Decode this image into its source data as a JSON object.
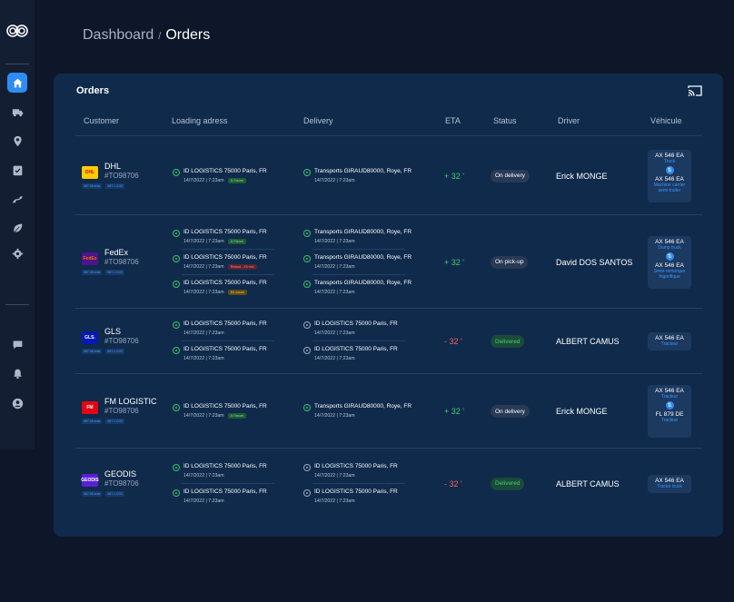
{
  "breadcrumb": {
    "parent": "Dashboard",
    "separator": "/",
    "current": "Orders"
  },
  "orders_title": "Orders",
  "columns": [
    "Customer",
    "Loading adress",
    "Delivery",
    "ETA",
    "Status",
    "Driver",
    "Véhicule"
  ],
  "sidebar": {
    "nav": [
      "home-icon",
      "truck-icon",
      "map-pin-icon",
      "clipboard-check-icon",
      "route-icon",
      "leaf-icon",
      "gear-icon"
    ],
    "bottom": [
      "chat-icon",
      "bell-icon",
      "user-icon"
    ],
    "accent": "#2f8cf4"
  },
  "rows": [
    {
      "customer": {
        "name": "DHL",
        "id": "#TO98706",
        "logo_text": "DHL",
        "logo_bg": "#ffcc00",
        "logo_fg": "#d40511",
        "tags": [
          "987.08 ents",
          "987.1 CO2"
        ]
      },
      "loading": [
        {
          "addr": "ID LOGISTICS 75000 Paris, FR",
          "time": "14/7/2022 | 7:23am",
          "badge": "A l'heure",
          "badge_type": "green"
        }
      ],
      "delivery": [
        {
          "addr": "Transports GIRAUD80000, Roye, FR",
          "time": "14/7/2022 | 7:23am"
        }
      ],
      "eta": "+ 32 '",
      "eta_type": "pos",
      "status": "On delivery",
      "status_type": "grey",
      "driver": "Erick MONGE",
      "vehicles": [
        {
          "plate": "AX 546 EA",
          "type": "Truck"
        },
        {
          "plate": "AX 546 EA",
          "type": "Machine carrier semi-trailer"
        }
      ]
    },
    {
      "customer": {
        "name": "FedEx",
        "id": "#TO98706",
        "logo_text": "FedEx",
        "logo_bg": "#4d148c",
        "logo_fg": "#ff6600",
        "tags": [
          "987.08 ents",
          "987.1 CO2"
        ]
      },
      "loading": [
        {
          "addr": "ID LOGISTICS 75000 Paris, FR",
          "time": "14/7/2022 | 7:23am",
          "badge": "A l'heure",
          "badge_type": "green"
        },
        {
          "addr": "ID LOGISTICS 75000 Paris, FR",
          "time": "14/7/2022 | 7:23am",
          "badge": "Retard - 25 min",
          "badge_type": "red"
        },
        {
          "addr": "ID LOGISTICS 75000 Paris, FR",
          "time": "14/7/2022 | 7:23am",
          "badge": "En cours",
          "badge_type": "amber"
        }
      ],
      "delivery": [
        {
          "addr": "Transports GIRAUD80000, Roye, FR",
          "time": "14/7/2022 | 7:23am"
        },
        {
          "addr": "Transports GIRAUD80000, Roye, FR",
          "time": "14/7/2022 | 7:23am"
        },
        {
          "addr": "Transports GIRAUD80000, Roye, FR",
          "time": "14/7/2022 | 7:23am"
        }
      ],
      "eta": "+ 32 '",
      "eta_type": "pos",
      "status": "On pick-up",
      "status_type": "grey",
      "driver": "David DOS SANTOS",
      "vehicles": [
        {
          "plate": "AX 546 EA",
          "type": "Dump truck"
        },
        {
          "plate": "AX 546 EA",
          "type": "Semi-remorque frigorifique"
        }
      ]
    },
    {
      "customer": {
        "name": "GLS",
        "id": "#TO98706",
        "logo_text": "GLS.",
        "logo_bg": "#061ab1",
        "logo_fg": "#ffffff",
        "tags": [
          "987.08 ents",
          "987.1 CO2"
        ]
      },
      "loading": [
        {
          "addr": "ID LOGISTICS 75000 Paris, FR",
          "time": "14/7/2022 | 7:23am"
        },
        {
          "addr": "ID LOGISTICS 75000 Paris, FR",
          "time": "14/7/2022 | 7:23am"
        }
      ],
      "delivery": [
        {
          "addr": "ID LOGISTICS 75000 Paris, FR",
          "time": "14/7/2022 | 7:23am"
        },
        {
          "addr": "ID LOGISTICS 75000 Paris, FR",
          "time": "14/7/2022 | 7:23am"
        }
      ],
      "eta": "- 32 '",
      "eta_type": "neg",
      "status": "Delivered",
      "status_type": "green",
      "driver": "ALBERT CAMUS",
      "vehicles": [
        {
          "plate": "AX 546 EA",
          "type": "Tracteur"
        }
      ]
    },
    {
      "customer": {
        "name": "FM LOGISTIC",
        "id": "#TO98706",
        "logo_text": "FM",
        "logo_bg": "#e30613",
        "logo_fg": "#ffffff",
        "tags": [
          "987.08 ents",
          "987.1 CO2"
        ]
      },
      "loading": [
        {
          "addr": "ID LOGISTICS 75000 Paris, FR",
          "time": "14/7/2022 | 7:23am",
          "badge": "A l'heure",
          "badge_type": "green"
        }
      ],
      "delivery": [
        {
          "addr": "Transports GIRAUD80000, Roye, FR",
          "time": "14/7/2022 | 7:23am"
        }
      ],
      "eta": "+ 32 '",
      "eta_type": "pos",
      "status": "On delivery",
      "status_type": "grey",
      "driver": "Erick MONGE",
      "vehicles": [
        {
          "plate": "AX 546 EA",
          "type": "Tracteur"
        },
        {
          "plate": "FL 879 DE",
          "type": "Tracteur"
        }
      ]
    },
    {
      "customer": {
        "name": "GEODIS",
        "id": "#TO98706",
        "logo_text": "GEODIS",
        "logo_bg": "#5a20d8",
        "logo_fg": "#ffffff",
        "tags": [
          "987.08 ents",
          "987.1 CO2"
        ]
      },
      "loading": [
        {
          "addr": "ID LOGISTICS 75000 Paris, FR",
          "time": "14/7/2022 | 7:23am"
        },
        {
          "addr": "ID LOGISTICS 75000 Paris, FR",
          "time": "14/7/2022 | 7:23am"
        }
      ],
      "delivery": [
        {
          "addr": "ID LOGISTICS 75000 Paris, FR",
          "time": "14/7/2022 | 7:23am"
        },
        {
          "addr": "ID LOGISTICS 75000 Paris, FR",
          "time": "14/7/2022 | 7:23am"
        }
      ],
      "eta": "- 32 '",
      "eta_type": "neg",
      "status": "Delivered",
      "status_type": "green",
      "driver": "ALBERT CAMUS",
      "vehicles": [
        {
          "plate": "AX 546 EA",
          "type": "Tractor truck"
        }
      ]
    }
  ]
}
